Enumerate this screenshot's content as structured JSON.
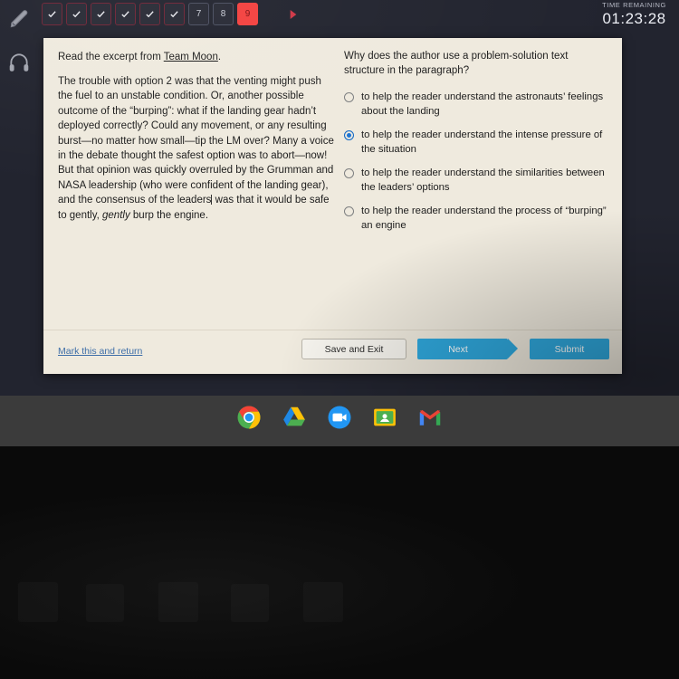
{
  "top_bar": {
    "question_buttons": [
      {
        "label": "",
        "state": "completed",
        "icon": "check-icon"
      },
      {
        "label": "",
        "state": "completed",
        "icon": "check-icon"
      },
      {
        "label": "",
        "state": "completed",
        "icon": "check-icon"
      },
      {
        "label": "",
        "state": "completed",
        "icon": "check-icon"
      },
      {
        "label": "",
        "state": "completed",
        "icon": "check-icon"
      },
      {
        "label": "",
        "state": "completed",
        "icon": "check-icon"
      },
      {
        "label": "7",
        "state": "unanswered",
        "icon": ""
      },
      {
        "label": "8",
        "state": "unanswered",
        "icon": ""
      },
      {
        "label": "9",
        "state": "current",
        "icon": ""
      }
    ],
    "next_arrow_icon": "arrow-right-icon",
    "timer_label": "TIME REMAINING",
    "timer_value": "01:23:28"
  },
  "tool_rail": {
    "items": [
      {
        "icon": "highlighter-icon",
        "name": "highlighter-tool"
      },
      {
        "icon": "headphones-icon",
        "name": "audio-tool"
      }
    ]
  },
  "passage": {
    "prompt_before": "Read the excerpt from ",
    "title": "Team Moon",
    "prompt_after": ".",
    "body_part1": "The trouble with option 2 was that the venting might push the fuel to an unstable condition. Or, another possible outcome of the “burping”: what if the landing gear hadn’t deployed correctly? Could any movement, or any resulting burst—no matter how small—tip the LM over? Many a voice in the debate thought the safest option was to abort—now! But that opinion was quickly overruled by the Grumman and NASA leadership (who were confident of the landing gear), and the consensus of the leaders",
    "body_part2": " was that it would be safe to gently, ",
    "body_emphasis": "gently",
    "body_part3": " burp the engine."
  },
  "question": {
    "text": "Why does the author use a problem-solution text structure in the paragraph?",
    "options": [
      {
        "label": "to help the reader understand the astronauts’ feelings about the landing",
        "selected": false
      },
      {
        "label": "to help the reader understand the intense pressure of the situation",
        "selected": true
      },
      {
        "label": "to help the reader understand the similarities between the leaders’ options",
        "selected": false
      },
      {
        "label": "to help the reader understand the process of “burping” an engine",
        "selected": false
      }
    ]
  },
  "footer": {
    "mark_return_label": "Mark this and return",
    "save_exit_label": "Save and Exit",
    "next_label": "Next",
    "submit_label": "Submit"
  },
  "shelf": {
    "icons": [
      {
        "name": "chrome-icon",
        "label": "Chrome"
      },
      {
        "name": "google-drive-icon",
        "label": "Drive"
      },
      {
        "name": "google-meet-icon",
        "label": "Meet"
      },
      {
        "name": "google-classroom-icon",
        "label": "Classroom"
      },
      {
        "name": "gmail-icon",
        "label": "Gmail"
      }
    ]
  },
  "colors": {
    "card_background": "#efeade",
    "screen_background": "#22242f",
    "accent_blue": "#2fa8dd",
    "selected_radio": "#1b73d4",
    "current_question": "#f4413f",
    "link_blue": "#3f6fa8"
  }
}
